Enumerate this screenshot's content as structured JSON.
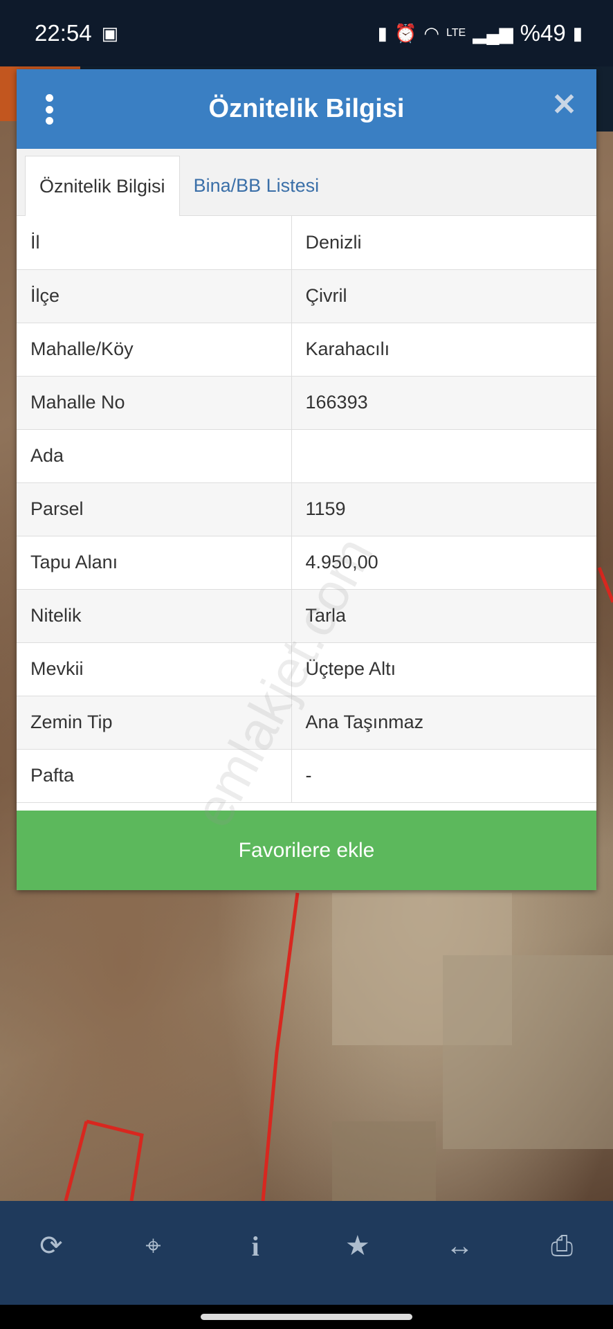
{
  "status_bar": {
    "time": "22:54",
    "battery": "%49",
    "icons": [
      "image-icon",
      "battery-saver-icon",
      "alarm-icon",
      "wifi-icon",
      "volte-icon",
      "signal-icon",
      "battery-icon"
    ]
  },
  "dialog": {
    "title": "Öznitelik Bilgisi",
    "tabs": [
      {
        "label": "Öznitelik Bilgisi",
        "active": true
      },
      {
        "label": "Bina/BB Listesi",
        "active": false
      }
    ],
    "rows": [
      {
        "key": "İl",
        "value": "Denizli"
      },
      {
        "key": "İlçe",
        "value": "Çivril"
      },
      {
        "key": "Mahalle/Köy",
        "value": "Karahacılı"
      },
      {
        "key": "Mahalle No",
        "value": "166393"
      },
      {
        "key": "Ada",
        "value": ""
      },
      {
        "key": "Parsel",
        "value": "1159"
      },
      {
        "key": "Tapu Alanı",
        "value": "4.950,00"
      },
      {
        "key": "Nitelik",
        "value": "Tarla"
      },
      {
        "key": "Mevkii",
        "value": "Üçtepe Altı"
      },
      {
        "key": "Zemin Tip",
        "value": "Ana Taşınmaz"
      },
      {
        "key": "Pafta",
        "value": "-"
      }
    ],
    "favorite_button": "Favorilere ekle",
    "watermark": "emlakjet.com"
  },
  "toolbar": {
    "items": [
      "refresh-icon",
      "locate-icon",
      "info-icon",
      "star-icon",
      "measure-icon",
      "print-icon"
    ]
  },
  "colors": {
    "header": "#3a7fc3",
    "button": "#5cb85c",
    "toolbar": "#1f3a5c",
    "statusbar": "#0e1a2b",
    "parcel_line": "#d8271f"
  }
}
